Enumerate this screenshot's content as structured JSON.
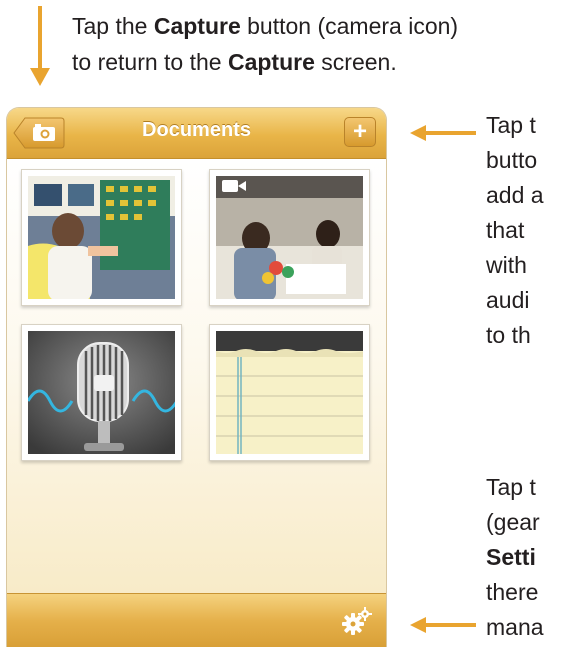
{
  "captions": {
    "top_line1_pre": "Tap the ",
    "top_line1_bold": "Capture",
    "top_line1_post": " button (camera icon)",
    "top_line2_pre": "to return to the ",
    "top_line2_bold": "Capture",
    "top_line2_post": " screen.",
    "plus_lines": [
      "Tap t",
      "butto",
      "add a",
      "that",
      "with",
      "audi",
      "to th"
    ],
    "gear_line1": "Tap t",
    "gear_line2": "(gear",
    "gear_line3_bold": "Setti",
    "gear_line4": "there",
    "gear_line5": "mana"
  },
  "navbar": {
    "title": "Documents",
    "back_icon": "camera-icon",
    "add_label": "+"
  },
  "documents": [
    {
      "kind": "photo",
      "subject": "child-at-wall-display"
    },
    {
      "kind": "video",
      "subject": "teacher-and-child-at-table",
      "badge_icon": "video-camera-icon"
    },
    {
      "kind": "audio",
      "subject": "microphone"
    },
    {
      "kind": "note",
      "subject": "notepad"
    }
  ],
  "toolbar": {
    "settings_icon": "gear-icon"
  },
  "colors": {
    "accent_orange": "#e9a42f",
    "navbar_gold": "#e9b548",
    "arrow": "#e9a42f"
  }
}
